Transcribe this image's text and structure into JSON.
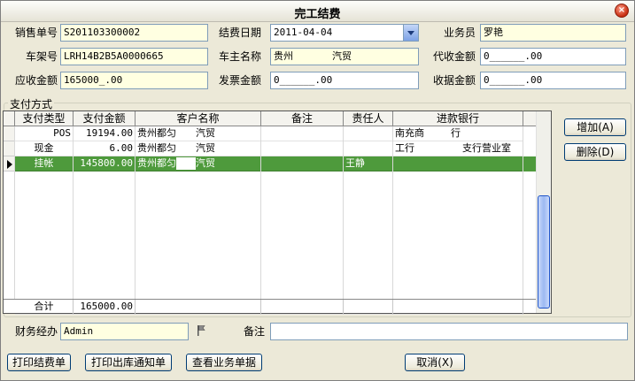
{
  "window": {
    "title": "完工结费",
    "close_glyph": "×"
  },
  "form": {
    "sales_no_label": "销售单号",
    "sales_no": "S201103300002",
    "settle_date_label": "结费日期",
    "settle_date": "2011-04-04",
    "salesperson_label": "业务员",
    "salesperson": "罗艳",
    "vin_label": "车架号",
    "vin": "LRH14B2B5A0000665",
    "owner_label": "车主名称",
    "owner_prefix": "贵州",
    "owner_suffix": "汽贸",
    "collect_label": "代收金额",
    "collect": "0______.00",
    "receivable_label": "应收金额",
    "receivable": "165000_.00",
    "invoice_label": "发票金额",
    "invoice": "0______.00",
    "receipt_label": "收据金额",
    "receipt": "0______.00"
  },
  "payment": {
    "group_title": "支付方式",
    "columns": [
      "支付类型",
      "支付金额",
      "客户名称",
      "备注",
      "责任人",
      "进款银行"
    ],
    "rows": [
      {
        "type": "POS",
        "amount": "19194.00",
        "customer_a": "贵州都匀",
        "customer_b": "汽贸",
        "note": "",
        "person": "",
        "bank_a": "南充商",
        "bank_b": "行",
        "selected": false
      },
      {
        "type": "现金",
        "amount": "6.00",
        "customer_a": "贵州都匀",
        "customer_b": "汽贸",
        "note": "",
        "person": "",
        "bank_a": "工行",
        "bank_b": "支行营业室",
        "selected": false
      },
      {
        "type": "挂帐",
        "amount": "145800.00",
        "customer_a": "贵州都匀",
        "customer_b": "汽贸",
        "note": "",
        "person": "王静",
        "bank_a": "",
        "bank_b": "",
        "selected": true
      }
    ],
    "total_label": "合计",
    "total_amount": "165000.00",
    "add_button": "增加(A)",
    "delete_button": "删除(D)"
  },
  "footer": {
    "finance_label": "财务经办",
    "finance": "Admin",
    "remark_label": "备注",
    "remark": ""
  },
  "actions": {
    "print_settlement": "打印结费单",
    "print_outbound": "打印出库通知单",
    "view_business": "查看业务单据",
    "cancel": "取消(X)"
  },
  "colors": {
    "selected_row": "#4e9a3c",
    "field_yellow": "#ffffe1"
  },
  "icons": {
    "close": "close-icon",
    "dropdown": "chevron-down-icon",
    "picker": "flag-icon",
    "row_pointer": "row-pointer-icon"
  }
}
